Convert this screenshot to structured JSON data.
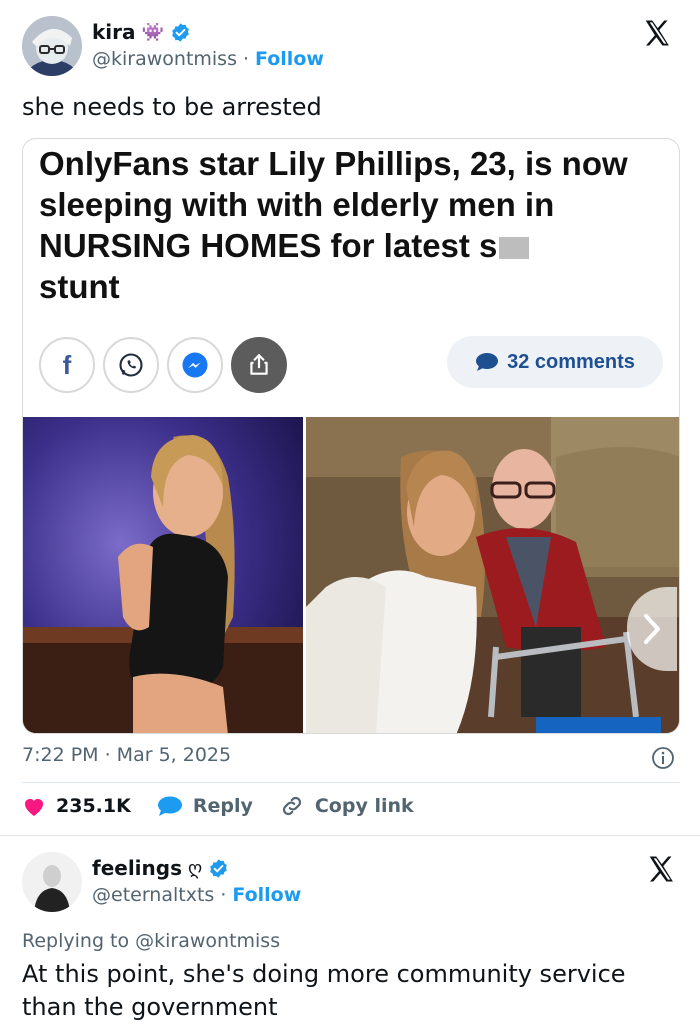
{
  "tweet1": {
    "display_name": "kira",
    "emoji": "👾",
    "handle": "@kirawontmiss",
    "separator": "·",
    "follow_label": "Follow",
    "text": "she needs to be arrested",
    "article": {
      "headline_main": "OnlyFans star Lily Phillips, 23, is now sleeping with with elderly men in NURSING HOMES for latest s",
      "headline_tail": "stunt",
      "comments_label": "32 comments",
      "share_buttons": [
        "facebook-icon",
        "whatsapp-icon",
        "messenger-icon",
        "share-icon"
      ]
    },
    "timestamp": "7:22 PM · Mar 5, 2025",
    "likes": "235.1K",
    "reply_label": "Reply",
    "copy_label": "Copy link"
  },
  "tweet2": {
    "display_name": "feelings",
    "emoji": "ღ",
    "handle": "@eternaltxts",
    "separator": "·",
    "follow_label": "Follow",
    "replying_prefix": "Replying to",
    "replying_handle": "@kirawontmiss",
    "text": "At this point, she's doing more community service than the government"
  },
  "colors": {
    "link_blue": "#1d9bf0",
    "like_red": "#f91880",
    "secondary_text": "#536471"
  }
}
